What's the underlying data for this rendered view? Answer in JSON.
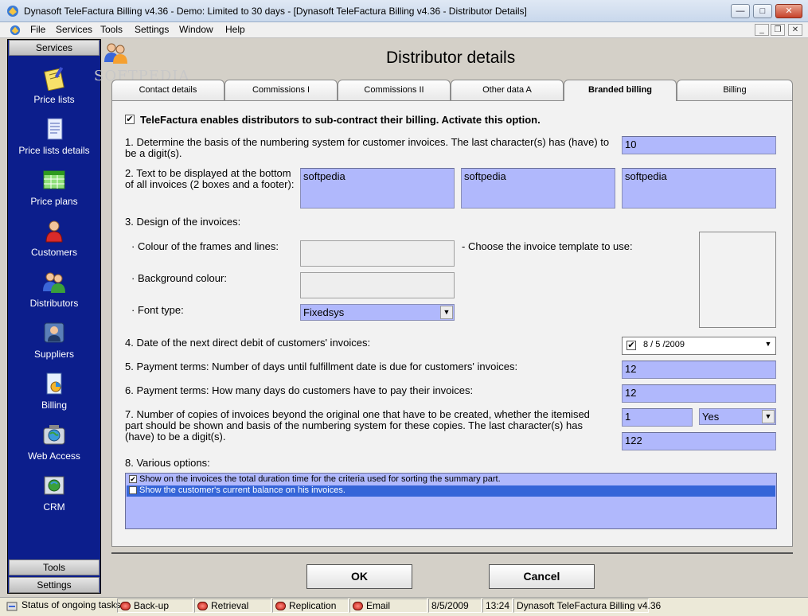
{
  "window": {
    "title": "Dynasoft TeleFactura Billing v4.36 - Demo: Limited to 30 days - [Dynasoft TeleFactura Billing v4.36 - Distributor Details]",
    "minimize": "—",
    "maximize": "□",
    "close": "✕"
  },
  "menu": {
    "items": [
      "File",
      "Services",
      "Tools",
      "Settings",
      "Window",
      "Help"
    ],
    "mdi_min": "_",
    "mdi_restore": "❐",
    "mdi_close": "✕"
  },
  "sidebar": {
    "top_header": "Services",
    "items": [
      {
        "label": "Price lists",
        "icon": "notepad-icon"
      },
      {
        "label": "Price lists details",
        "icon": "document-icon"
      },
      {
        "label": "Price plans",
        "icon": "spreadsheet-icon"
      },
      {
        "label": "Customers",
        "icon": "person-icon"
      },
      {
        "label": "Distributors",
        "icon": "people-icon"
      },
      {
        "label": "Suppliers",
        "icon": "supplier-icon"
      },
      {
        "label": "Billing",
        "icon": "billing-icon"
      },
      {
        "label": "Web Access",
        "icon": "globe-icon"
      },
      {
        "label": "CRM",
        "icon": "crm-icon"
      }
    ],
    "bottom_headers": [
      "Tools",
      "Settings"
    ]
  },
  "page": {
    "title": "Distributor details",
    "watermark": "SOFTPEDIA"
  },
  "tabs": [
    {
      "label": "Contact details",
      "active": false
    },
    {
      "label": "Commissions I",
      "active": false
    },
    {
      "label": "Commissions II",
      "active": false
    },
    {
      "label": "Other data A",
      "active": false
    },
    {
      "label": "Branded billing",
      "active": true
    },
    {
      "label": "Billing",
      "active": false
    }
  ],
  "form": {
    "activate_label": "TeleFactura enables distributors to sub-contract their billing. Activate this option.",
    "activate_checked": "✔",
    "q1_label": "1. Determine the basis of the numbering system for customer invoices. The last character(s) has (have) to be a digit(s).",
    "q1_value": "10",
    "q2_label": "2. Text to be displayed at the bottom of all invoices (2 boxes and a footer):",
    "q2_values": [
      "softpedia",
      "softpedia",
      "softpedia"
    ],
    "q3_label": "3. Design of the invoices:",
    "frames_label": "· Colour of the frames and lines:",
    "background_label": "· Background colour:",
    "font_label": "· Font type:",
    "font_value": "Fixedsys",
    "template_label": "- Choose the invoice template to use:",
    "q4_label": "4. Date of the next direct debit of customers' invoices:",
    "q4_value": "8 / 5 /2009",
    "q4_checked": "✔",
    "q5_label": "5. Payment terms: Number of days until fulfillment date is due for customers' invoices:",
    "q5_value": "12",
    "q6_label": "6. Payment terms: How many days do customers have to pay their invoices:",
    "q6_value": "12",
    "q7_label": "7. Number of copies of invoices beyond the original one that have to be created, whether the itemised part should be shown and basis of the numbering system for these copies. The last character(s) has (have) to be a digit(s).",
    "q7_copies": "1",
    "q7_itemised": "Yes",
    "q7_basis": "122",
    "q8_label": "8. Various options:",
    "options": [
      {
        "text": "Show on the invoices the total duration time for the criteria used for sorting the summary part.",
        "checked": "✔",
        "selected": false
      },
      {
        "text": "Show the customer's current balance on his invoices.",
        "checked": "✔",
        "selected": true
      }
    ],
    "dropdown_arrow": "▼"
  },
  "buttons": {
    "ok": "OK",
    "cancel": "Cancel"
  },
  "statusbar": {
    "label": "Status of ongoing tasks:",
    "tasks": [
      "Back-up",
      "Retrieval",
      "Replication",
      "Email"
    ],
    "date": "8/5/2009",
    "time": "13:24",
    "app": "Dynasoft TeleFactura Billing v4.36"
  }
}
